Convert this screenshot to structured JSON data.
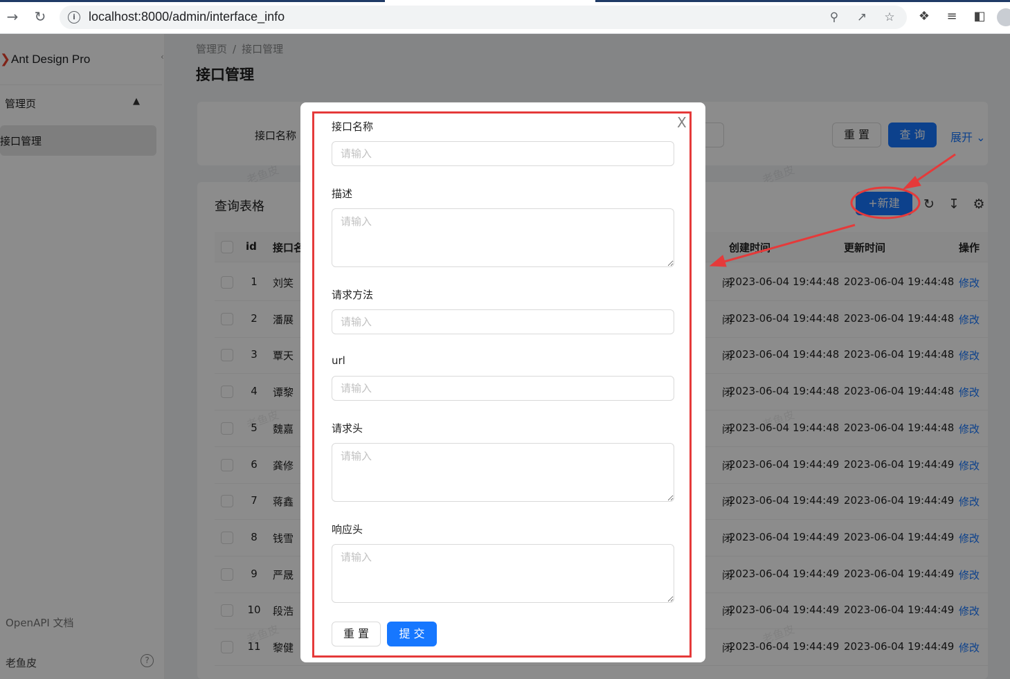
{
  "browser": {
    "url": "localhost:8000/admin/interface_info"
  },
  "sidebar": {
    "logo": "Ant Design Pro",
    "group": "管理页",
    "item": "接口管理",
    "footer_link": "OpenAPI 文档",
    "user": "老鱼皮",
    "help": "?"
  },
  "page": {
    "breadcrumb": [
      "管理页",
      "接口管理"
    ],
    "breadcrumb_sep": "/",
    "title": "接口管理"
  },
  "search": {
    "label": "接口名称",
    "reset": "重 置",
    "query": "查 询",
    "expand": "展开"
  },
  "table": {
    "title": "查询表格",
    "new_button": "+新建",
    "columns": {
      "id": "id",
      "name": "接口名",
      "created": "创建时间",
      "updated": "更新时间",
      "action": "操作"
    },
    "rows": [
      {
        "id": "1",
        "name": "刘笑",
        "status": "闭",
        "created": "2023-06-04 19:44:48",
        "updated": "2023-06-04 19:44:48",
        "action": "修改"
      },
      {
        "id": "2",
        "name": "潘展",
        "status": "闭",
        "created": "2023-06-04 19:44:48",
        "updated": "2023-06-04 19:44:48",
        "action": "修改"
      },
      {
        "id": "3",
        "name": "覃天",
        "status": "闭",
        "created": "2023-06-04 19:44:48",
        "updated": "2023-06-04 19:44:48",
        "action": "修改"
      },
      {
        "id": "4",
        "name": "谭黎",
        "status": "闭",
        "created": "2023-06-04 19:44:48",
        "updated": "2023-06-04 19:44:48",
        "action": "修改"
      },
      {
        "id": "5",
        "name": "魏嘉",
        "status": "闭",
        "created": "2023-06-04 19:44:48",
        "updated": "2023-06-04 19:44:48",
        "action": "修改"
      },
      {
        "id": "6",
        "name": "龚修",
        "status": "闭",
        "created": "2023-06-04 19:44:49",
        "updated": "2023-06-04 19:44:49",
        "action": "修改"
      },
      {
        "id": "7",
        "name": "蒋鑫",
        "status": "闭",
        "created": "2023-06-04 19:44:49",
        "updated": "2023-06-04 19:44:49",
        "action": "修改"
      },
      {
        "id": "8",
        "name": "钱雪",
        "status": "闭",
        "created": "2023-06-04 19:44:49",
        "updated": "2023-06-04 19:44:49",
        "action": "修改"
      },
      {
        "id": "9",
        "name": "严晟",
        "status": "闭",
        "created": "2023-06-04 19:44:49",
        "updated": "2023-06-04 19:44:49",
        "action": "修改"
      },
      {
        "id": "10",
        "name": "段浩",
        "status": "闭",
        "created": "2023-06-04 19:44:49",
        "updated": "2023-06-04 19:44:49",
        "action": "修改"
      },
      {
        "id": "11",
        "name": "黎健",
        "status": "闭",
        "created": "2023-06-04 19:44:49",
        "updated": "2023-06-04 19:44:49",
        "action": "修改"
      }
    ]
  },
  "watermark": "老鱼皮",
  "modal": {
    "close": "X",
    "fields": [
      {
        "label": "接口名称",
        "placeholder": "请输入",
        "type": "input"
      },
      {
        "label": "描述",
        "placeholder": "请输入",
        "type": "textarea"
      },
      {
        "label": "请求方法",
        "placeholder": "请输入",
        "type": "input"
      },
      {
        "label": "url",
        "placeholder": "请输入",
        "type": "input"
      },
      {
        "label": "请求头",
        "placeholder": "请输入",
        "type": "textarea"
      },
      {
        "label": "响应头",
        "placeholder": "请输入",
        "type": "textarea"
      }
    ],
    "reset": "重 置",
    "submit": "提 交"
  },
  "colors": {
    "primary": "#1677ff",
    "annotation": "#e53a3a",
    "logo": "#e8402d"
  }
}
